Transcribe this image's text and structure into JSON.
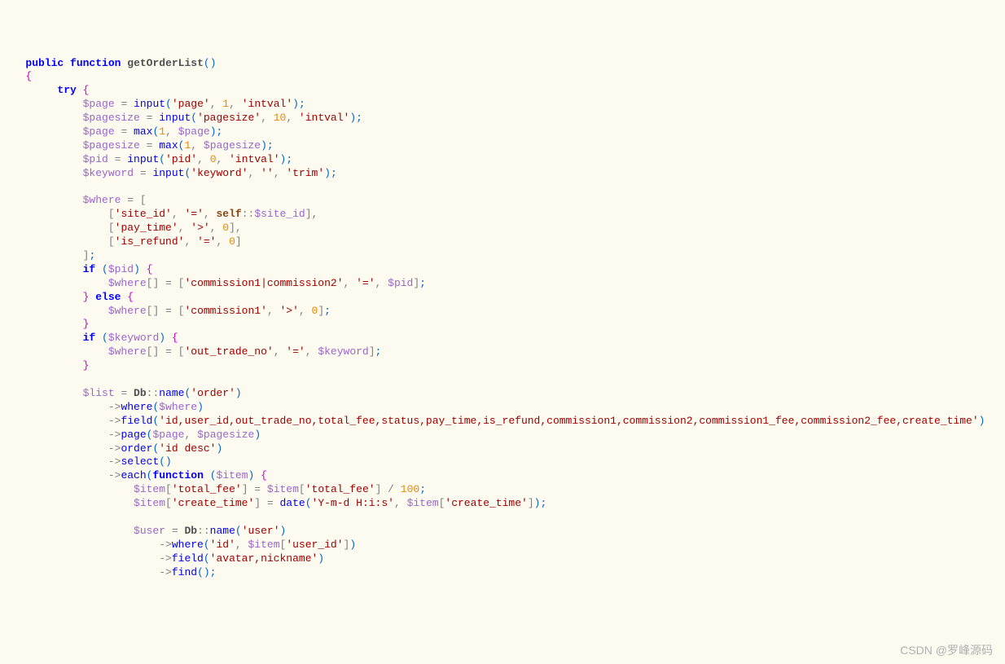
{
  "tokens": [
    [
      [
        "   ",
        "plain"
      ],
      [
        "public",
        "keyword"
      ],
      [
        " ",
        "plain"
      ],
      [
        "function",
        "keyword"
      ],
      [
        " ",
        "plain"
      ],
      [
        "getOrderList",
        "func-name"
      ],
      [
        "()",
        "paren"
      ]
    ],
    [
      [
        "   ",
        "plain"
      ],
      [
        "{",
        "brace"
      ]
    ],
    [
      [
        "        ",
        "plain"
      ],
      [
        "try",
        "keyword"
      ],
      [
        " ",
        "plain"
      ],
      [
        "{",
        "brace"
      ]
    ],
    [
      [
        "            ",
        "plain"
      ],
      [
        "$page",
        "variable"
      ],
      [
        " = ",
        "operator"
      ],
      [
        "input",
        "func-call"
      ],
      [
        "(",
        "paren"
      ],
      [
        "'page'",
        "string"
      ],
      [
        ", ",
        "comma"
      ],
      [
        "1",
        "number"
      ],
      [
        ", ",
        "comma"
      ],
      [
        "'intval'",
        "string"
      ],
      [
        ")",
        "paren"
      ],
      [
        ";",
        "semi"
      ]
    ],
    [
      [
        "            ",
        "plain"
      ],
      [
        "$pagesize",
        "variable"
      ],
      [
        " = ",
        "operator"
      ],
      [
        "input",
        "func-call"
      ],
      [
        "(",
        "paren"
      ],
      [
        "'pagesize'",
        "string"
      ],
      [
        ", ",
        "comma"
      ],
      [
        "10",
        "number"
      ],
      [
        ", ",
        "comma"
      ],
      [
        "'intval'",
        "string"
      ],
      [
        ")",
        "paren"
      ],
      [
        ";",
        "semi"
      ]
    ],
    [
      [
        "            ",
        "plain"
      ],
      [
        "$page",
        "variable"
      ],
      [
        " = ",
        "operator"
      ],
      [
        "max",
        "func-call"
      ],
      [
        "(",
        "paren"
      ],
      [
        "1",
        "number"
      ],
      [
        ", ",
        "comma"
      ],
      [
        "$page",
        "variable"
      ],
      [
        ")",
        "paren"
      ],
      [
        ";",
        "semi"
      ]
    ],
    [
      [
        "            ",
        "plain"
      ],
      [
        "$pagesize",
        "variable"
      ],
      [
        " = ",
        "operator"
      ],
      [
        "max",
        "func-call"
      ],
      [
        "(",
        "paren"
      ],
      [
        "1",
        "number"
      ],
      [
        ", ",
        "comma"
      ],
      [
        "$pagesize",
        "variable"
      ],
      [
        ")",
        "paren"
      ],
      [
        ";",
        "semi"
      ]
    ],
    [
      [
        "            ",
        "plain"
      ],
      [
        "$pid",
        "variable"
      ],
      [
        " = ",
        "operator"
      ],
      [
        "input",
        "func-call"
      ],
      [
        "(",
        "paren"
      ],
      [
        "'pid'",
        "string"
      ],
      [
        ", ",
        "comma"
      ],
      [
        "0",
        "number"
      ],
      [
        ", ",
        "comma"
      ],
      [
        "'intval'",
        "string"
      ],
      [
        ")",
        "paren"
      ],
      [
        ";",
        "semi"
      ]
    ],
    [
      [
        "            ",
        "plain"
      ],
      [
        "$keyword",
        "variable"
      ],
      [
        " = ",
        "operator"
      ],
      [
        "input",
        "func-call"
      ],
      [
        "(",
        "paren"
      ],
      [
        "'keyword'",
        "string"
      ],
      [
        ", ",
        "comma"
      ],
      [
        "''",
        "string"
      ],
      [
        ", ",
        "comma"
      ],
      [
        "'trim'",
        "string"
      ],
      [
        ")",
        "paren"
      ],
      [
        ";",
        "semi"
      ]
    ],
    [
      [
        " ",
        "plain"
      ]
    ],
    [
      [
        "            ",
        "plain"
      ],
      [
        "$where",
        "variable"
      ],
      [
        " = ",
        "operator"
      ],
      [
        "[",
        "bracket"
      ]
    ],
    [
      [
        "                ",
        "plain"
      ],
      [
        "[",
        "bracket"
      ],
      [
        "'site_id'",
        "string"
      ],
      [
        ", ",
        "comma"
      ],
      [
        "'='",
        "string"
      ],
      [
        ", ",
        "comma"
      ],
      [
        "self",
        "const"
      ],
      [
        "::",
        "static-access"
      ],
      [
        "$site_id",
        "variable"
      ],
      [
        "]",
        "bracket"
      ],
      [
        ",",
        "comma"
      ]
    ],
    [
      [
        "                ",
        "plain"
      ],
      [
        "[",
        "bracket"
      ],
      [
        "'pay_time'",
        "string"
      ],
      [
        ", ",
        "comma"
      ],
      [
        "'>'",
        "string"
      ],
      [
        ", ",
        "comma"
      ],
      [
        "0",
        "number"
      ],
      [
        "]",
        "bracket"
      ],
      [
        ",",
        "comma"
      ]
    ],
    [
      [
        "                ",
        "plain"
      ],
      [
        "[",
        "bracket"
      ],
      [
        "'is_refund'",
        "string"
      ],
      [
        ", ",
        "comma"
      ],
      [
        "'='",
        "string"
      ],
      [
        ", ",
        "comma"
      ],
      [
        "0",
        "number"
      ],
      [
        "]",
        "bracket"
      ]
    ],
    [
      [
        "            ",
        "plain"
      ],
      [
        "]",
        "bracket"
      ],
      [
        ";",
        "semi"
      ]
    ],
    [
      [
        "            ",
        "plain"
      ],
      [
        "if",
        "keyword"
      ],
      [
        " ",
        "plain"
      ],
      [
        "(",
        "paren"
      ],
      [
        "$pid",
        "variable"
      ],
      [
        ")",
        "paren"
      ],
      [
        " ",
        "plain"
      ],
      [
        "{",
        "brace"
      ]
    ],
    [
      [
        "                ",
        "plain"
      ],
      [
        "$where",
        "variable"
      ],
      [
        "[]",
        "bracket"
      ],
      [
        " = ",
        "operator"
      ],
      [
        "[",
        "bracket"
      ],
      [
        "'commission1|commission2'",
        "string"
      ],
      [
        ", ",
        "comma"
      ],
      [
        "'='",
        "string"
      ],
      [
        ", ",
        "comma"
      ],
      [
        "$pid",
        "variable"
      ],
      [
        "]",
        "bracket"
      ],
      [
        ";",
        "semi"
      ]
    ],
    [
      [
        "            ",
        "plain"
      ],
      [
        "}",
        "brace"
      ],
      [
        " ",
        "plain"
      ],
      [
        "else",
        "keyword"
      ],
      [
        " ",
        "plain"
      ],
      [
        "{",
        "brace"
      ]
    ],
    [
      [
        "                ",
        "plain"
      ],
      [
        "$where",
        "variable"
      ],
      [
        "[]",
        "bracket"
      ],
      [
        " = ",
        "operator"
      ],
      [
        "[",
        "bracket"
      ],
      [
        "'commission1'",
        "string"
      ],
      [
        ", ",
        "comma"
      ],
      [
        "'>'",
        "string"
      ],
      [
        ", ",
        "comma"
      ],
      [
        "0",
        "number"
      ],
      [
        "]",
        "bracket"
      ],
      [
        ";",
        "semi"
      ]
    ],
    [
      [
        "            ",
        "plain"
      ],
      [
        "}",
        "brace"
      ]
    ],
    [
      [
        "            ",
        "plain"
      ],
      [
        "if",
        "keyword"
      ],
      [
        " ",
        "plain"
      ],
      [
        "(",
        "paren"
      ],
      [
        "$keyword",
        "variable"
      ],
      [
        ")",
        "paren"
      ],
      [
        " ",
        "plain"
      ],
      [
        "{",
        "brace"
      ]
    ],
    [
      [
        "                ",
        "plain"
      ],
      [
        "$where",
        "variable"
      ],
      [
        "[]",
        "bracket"
      ],
      [
        " = ",
        "operator"
      ],
      [
        "[",
        "bracket"
      ],
      [
        "'out_trade_no'",
        "string"
      ],
      [
        ", ",
        "comma"
      ],
      [
        "'='",
        "string"
      ],
      [
        ", ",
        "comma"
      ],
      [
        "$keyword",
        "variable"
      ],
      [
        "]",
        "bracket"
      ],
      [
        ";",
        "semi"
      ]
    ],
    [
      [
        "            ",
        "plain"
      ],
      [
        "}",
        "brace"
      ]
    ],
    [
      [
        " ",
        "plain"
      ]
    ],
    [
      [
        "            ",
        "plain"
      ],
      [
        "$list",
        "variable"
      ],
      [
        " = ",
        "operator"
      ],
      [
        "Db",
        "func-name"
      ],
      [
        "::",
        "static-access"
      ],
      [
        "name",
        "func-call"
      ],
      [
        "(",
        "paren"
      ],
      [
        "'order'",
        "string"
      ],
      [
        ")",
        "paren"
      ]
    ],
    [
      [
        "                ",
        "plain"
      ],
      [
        "->",
        "operator"
      ],
      [
        "where",
        "func-call"
      ],
      [
        "(",
        "paren"
      ],
      [
        "$where",
        "variable"
      ],
      [
        ")",
        "paren"
      ]
    ],
    [
      [
        "                ",
        "plain"
      ],
      [
        "->",
        "operator"
      ],
      [
        "field",
        "func-call"
      ],
      [
        "(",
        "paren"
      ],
      [
        "'id,user_id,out_trade_no,total_fee,status,pay_time,is_refund,commission1,commission2,commission1_fee,commission2_fee,create_time'",
        "string"
      ],
      [
        ")",
        "paren"
      ]
    ],
    [
      [
        "                ",
        "plain"
      ],
      [
        "->",
        "operator"
      ],
      [
        "page",
        "func-call"
      ],
      [
        "(",
        "paren"
      ],
      [
        "$page",
        "variable"
      ],
      [
        ", ",
        "comma"
      ],
      [
        "$pagesize",
        "variable"
      ],
      [
        ")",
        "paren"
      ]
    ],
    [
      [
        "                ",
        "plain"
      ],
      [
        "->",
        "operator"
      ],
      [
        "order",
        "func-call"
      ],
      [
        "(",
        "paren"
      ],
      [
        "'id desc'",
        "string"
      ],
      [
        ")",
        "paren"
      ]
    ],
    [
      [
        "                ",
        "plain"
      ],
      [
        "->",
        "operator"
      ],
      [
        "select",
        "func-call"
      ],
      [
        "()",
        "paren"
      ]
    ],
    [
      [
        "                ",
        "plain"
      ],
      [
        "->",
        "operator"
      ],
      [
        "each",
        "func-call"
      ],
      [
        "(",
        "paren"
      ],
      [
        "function",
        "keyword"
      ],
      [
        " ",
        "plain"
      ],
      [
        "(",
        "paren"
      ],
      [
        "$item",
        "variable"
      ],
      [
        ")",
        "paren"
      ],
      [
        " ",
        "plain"
      ],
      [
        "{",
        "brace"
      ]
    ],
    [
      [
        "                    ",
        "plain"
      ],
      [
        "$item",
        "variable"
      ],
      [
        "[",
        "bracket"
      ],
      [
        "'total_fee'",
        "string"
      ],
      [
        "]",
        "bracket"
      ],
      [
        " = ",
        "operator"
      ],
      [
        "$item",
        "variable"
      ],
      [
        "[",
        "bracket"
      ],
      [
        "'total_fee'",
        "string"
      ],
      [
        "]",
        "bracket"
      ],
      [
        " / ",
        "operator"
      ],
      [
        "100",
        "number"
      ],
      [
        ";",
        "semi"
      ]
    ],
    [
      [
        "                    ",
        "plain"
      ],
      [
        "$item",
        "variable"
      ],
      [
        "[",
        "bracket"
      ],
      [
        "'create_time'",
        "string"
      ],
      [
        "]",
        "bracket"
      ],
      [
        " = ",
        "operator"
      ],
      [
        "date",
        "func-call"
      ],
      [
        "(",
        "paren"
      ],
      [
        "'Y-m-d H:i:s'",
        "string"
      ],
      [
        ", ",
        "comma"
      ],
      [
        "$item",
        "variable"
      ],
      [
        "[",
        "bracket"
      ],
      [
        "'create_time'",
        "string"
      ],
      [
        "]",
        "bracket"
      ],
      [
        ")",
        "paren"
      ],
      [
        ";",
        "semi"
      ]
    ],
    [
      [
        " ",
        "plain"
      ]
    ],
    [
      [
        "                    ",
        "plain"
      ],
      [
        "$user",
        "variable"
      ],
      [
        " = ",
        "operator"
      ],
      [
        "Db",
        "func-name"
      ],
      [
        "::",
        "static-access"
      ],
      [
        "name",
        "func-call"
      ],
      [
        "(",
        "paren"
      ],
      [
        "'user'",
        "string"
      ],
      [
        ")",
        "paren"
      ]
    ],
    [
      [
        "                        ",
        "plain"
      ],
      [
        "->",
        "operator"
      ],
      [
        "where",
        "func-call"
      ],
      [
        "(",
        "paren"
      ],
      [
        "'id'",
        "string"
      ],
      [
        ", ",
        "comma"
      ],
      [
        "$item",
        "variable"
      ],
      [
        "[",
        "bracket"
      ],
      [
        "'user_id'",
        "string"
      ],
      [
        "]",
        "bracket"
      ],
      [
        ")",
        "paren"
      ]
    ],
    [
      [
        "                        ",
        "plain"
      ],
      [
        "->",
        "operator"
      ],
      [
        "field",
        "func-call"
      ],
      [
        "(",
        "paren"
      ],
      [
        "'avatar,nickname'",
        "string"
      ],
      [
        ")",
        "paren"
      ]
    ],
    [
      [
        "                        ",
        "plain"
      ],
      [
        "->",
        "operator"
      ],
      [
        "find",
        "func-call"
      ],
      [
        "()",
        "paren"
      ],
      [
        ";",
        "semi"
      ]
    ]
  ],
  "watermark": "CSDN @罗峰源码"
}
